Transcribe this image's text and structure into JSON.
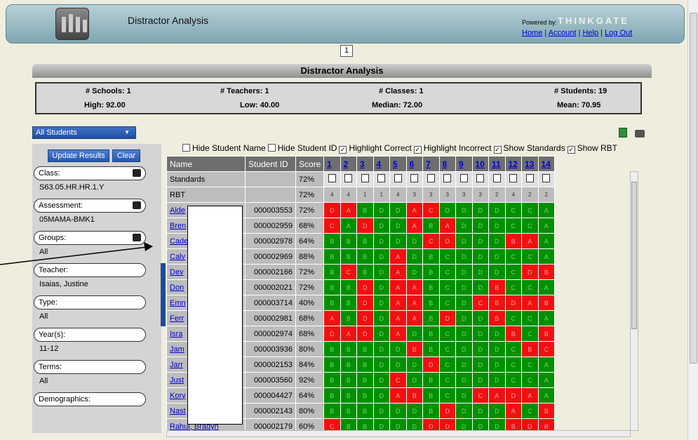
{
  "header": {
    "title": "Distractor Analysis",
    "powered_by": "Powered by:",
    "brand": "THINKGATE",
    "links": [
      "Home",
      "Account",
      "Help",
      "Log Out"
    ],
    "sep": "|"
  },
  "pager": {
    "current": "1"
  },
  "panel": {
    "title": "Distractor Analysis"
  },
  "stats": {
    "schools": "# Schools: 1",
    "teachers": "# Teachers: 1",
    "classes": "# Classes: 1",
    "students": "# Students: 19",
    "high": "High: 92.00",
    "low": "Low: 40.00",
    "median": "Median: 72.00",
    "mean": "Mean: 70.95"
  },
  "group_select": {
    "value": "All Students"
  },
  "sidebar": {
    "update_label": "Update Results",
    "clear_label": "Clear",
    "filters": [
      {
        "label": "Class:",
        "value": "S63.05.HR.HR.1.Y",
        "has_icon": true
      },
      {
        "label": "Assessment:",
        "value": "05MAMA-BMK1",
        "has_icon": true
      },
      {
        "label": "Groups:",
        "value": "All",
        "has_icon": true
      },
      {
        "label": "Teacher:",
        "value": "Isaias, Justine",
        "has_icon": false
      },
      {
        "label": "Type:",
        "value": "All",
        "has_icon": false
      },
      {
        "label": "Year(s):",
        "value": "11-12",
        "has_icon": false
      },
      {
        "label": "Terms:",
        "value": "All",
        "has_icon": false
      },
      {
        "label": "Demographics:",
        "value": "",
        "has_icon": false
      }
    ]
  },
  "options": [
    {
      "label": "Hide Student Name",
      "checked": false
    },
    {
      "label": "Hide Student ID",
      "checked": false
    },
    {
      "label": "Highlight Correct",
      "checked": true
    },
    {
      "label": "Highlight Incorrect",
      "checked": true
    },
    {
      "label": "Show Standards",
      "checked": true
    },
    {
      "label": "Show RBT",
      "checked": true
    }
  ],
  "grid": {
    "headers": {
      "name": "Name",
      "id": "Student ID",
      "score": "Score"
    },
    "questions": [
      "1",
      "2",
      "3",
      "4",
      "5",
      "6",
      "7",
      "8",
      "9",
      "10",
      "11",
      "12",
      "13",
      "14"
    ],
    "standards": {
      "label": "Standards",
      "score": "72%"
    },
    "rbt": {
      "label": "RBT",
      "score": "72%",
      "values": [
        "4",
        "4",
        "1",
        "1",
        "4",
        "3",
        "3",
        "3",
        "3",
        "3",
        "2",
        "4",
        "2",
        "2"
      ]
    },
    "rows": [
      {
        "name": "Alde",
        "id": "000003553",
        "score": "72%",
        "ans": "DABDDACDDDDCCA",
        "ok": "IIGGGIIGGGGGGG"
      },
      {
        "name": "Bren",
        "id": "000002959",
        "score": "68%",
        "ans": "CADDDABADDDCCA",
        "ok": "IGIGGIGIGGGGGG"
      },
      {
        "name": "Cade",
        "id": "000002978",
        "score": "64%",
        "ans": "BBBDDDCDDDDBAA",
        "ok": "GGGGGGIIGGGIIG"
      },
      {
        "name": "Calv",
        "id": "000002969",
        "score": "88%",
        "ans": "BBBDADBCDDDCCA",
        "ok": "GGGGIGGGGGGGGG"
      },
      {
        "name": "Dev",
        "id": "000002166",
        "score": "72%",
        "ans": "BCBDADBCDDDCDB",
        "ok": "GIGGIGGGGGGGII"
      },
      {
        "name": "Don",
        "id": "000002021",
        "score": "72%",
        "ans": "BBDDAABCDDBCCA",
        "ok": "GGIGIIGGGGIGGG"
      },
      {
        "name": "Emn",
        "id": "000003714",
        "score": "40%",
        "ans": "BBDDAABCDCBDAB",
        "ok": "GGIGIIGGGIIIII"
      },
      {
        "name": "Ferr",
        "id": "000002981",
        "score": "68%",
        "ans": "ABDDAABDDDBCCA",
        "ok": "IGIGIIGIGGIGGG"
      },
      {
        "name": "Isra",
        "id": "000002974",
        "score": "68%",
        "ans": "DADDADBCDDDBCB",
        "ok": "IIIGIGGGGGGIGI"
      },
      {
        "name": "Jam",
        "id": "000003936",
        "score": "80%",
        "ans": "BBBDDBBCDDDCBC",
        "ok": "GGGGGIGGGGGGII"
      },
      {
        "name": "Jarr",
        "id": "000002153",
        "score": "84%",
        "ans": "BBBDDDDCDDDCCA",
        "ok": "GGGGGGIGGGGGGG"
      },
      {
        "name": "Just",
        "id": "000003560",
        "score": "92%",
        "ans": "BBBDCDBCDDDCCA",
        "ok": "GGGGIGGGGGGGGG"
      },
      {
        "name": "Kory",
        "id": "000004427",
        "score": "64%",
        "ans": "BBBDABBCDCADAA",
        "ok": "GGGGIIGGGIIIIG"
      },
      {
        "name": "Nast",
        "id": "000002143",
        "score": "80%",
        "ans": "BBBDDDBDDDDACB",
        "ok": "GGGGGGGIGGGIGI"
      },
      {
        "name": "Rahul, Bradyn",
        "id": "000002179",
        "score": "60%",
        "ans": "CBBDDDDDDDDBDB",
        "ok": "IGGGGGIIGGGIII"
      }
    ]
  }
}
